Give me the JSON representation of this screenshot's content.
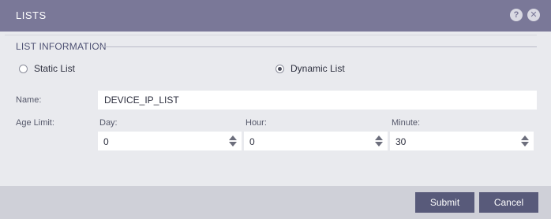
{
  "dialog": {
    "title": "LISTS",
    "help_icon": "help-icon",
    "help_glyph": "?",
    "close_icon": "close-icon",
    "close_glyph": "✕"
  },
  "section": {
    "title": "LIST INFORMATION"
  },
  "list_type": {
    "options": [
      {
        "label": "Static List",
        "selected": false
      },
      {
        "label": "Dynamic List",
        "selected": true
      }
    ]
  },
  "form": {
    "name_label": "Name:",
    "name_value": "DEVICE_IP_LIST",
    "age_limit_label": "Age Limit:",
    "day_label": "Day:",
    "day_value": "0",
    "hour_label": "Hour:",
    "hour_value": "0",
    "minute_label": "Minute:",
    "minute_value": "30"
  },
  "footer": {
    "submit_label": "Submit",
    "cancel_label": "Cancel"
  },
  "colors": {
    "titlebar": "#7a7898",
    "button": "#585a7a",
    "footer": "#cfd0d8",
    "body": "#e9eaee"
  }
}
